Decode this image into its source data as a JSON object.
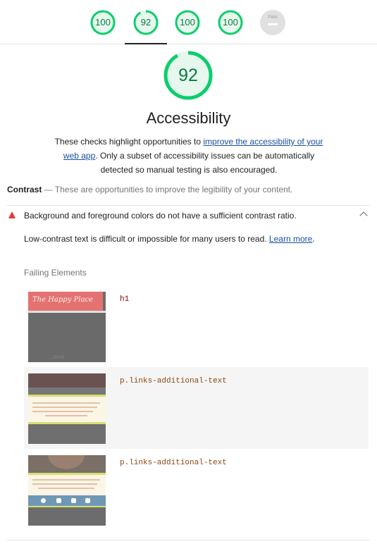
{
  "scores": [
    {
      "name": "performance",
      "value": "100",
      "fraction": 1.0,
      "color": "#0cce6b"
    },
    {
      "name": "accessibility",
      "value": "92",
      "fraction": 0.92,
      "color": "#0cce6b"
    },
    {
      "name": "best-practices",
      "value": "100",
      "fraction": 1.0,
      "color": "#0cce6b"
    },
    {
      "name": "seo",
      "value": "100",
      "fraction": 1.0,
      "color": "#0cce6b"
    },
    {
      "name": "pwa",
      "value": "PWA",
      "fraction": 0,
      "color": "#e0e0e0"
    }
  ],
  "category": {
    "score": "92",
    "fraction": 0.92,
    "title": "Accessibility",
    "desc_before": "These checks highlight opportunities to ",
    "desc_link": "improve the accessibility of your web app",
    "desc_after": ". Only a subset of accessibility issues can be automatically detected so manual testing is also encouraged."
  },
  "group": {
    "title": "Contrast",
    "separator": " — ",
    "description": "These are opportunities to improve the legibility of your content."
  },
  "audit": {
    "title": "Background and foreground colors do not have a sufficient contrast ratio.",
    "description": "Low-contrast text is difficult or impossible for many users to read. ",
    "learn_more": "Learn more",
    "period": ".",
    "failing_label": "Failing Elements",
    "elements": [
      {
        "selector": "h1",
        "thumb_text": "The Happy Place",
        "thumb_footer": "...Nord"
      },
      {
        "selector": "p.links-additional-text"
      },
      {
        "selector": "p.links-additional-text"
      }
    ]
  },
  "colors": {
    "pass": "#0cce6b",
    "pass_text": "#0c7a3e",
    "fail": "#e53935",
    "link": "#1a4fa0"
  }
}
